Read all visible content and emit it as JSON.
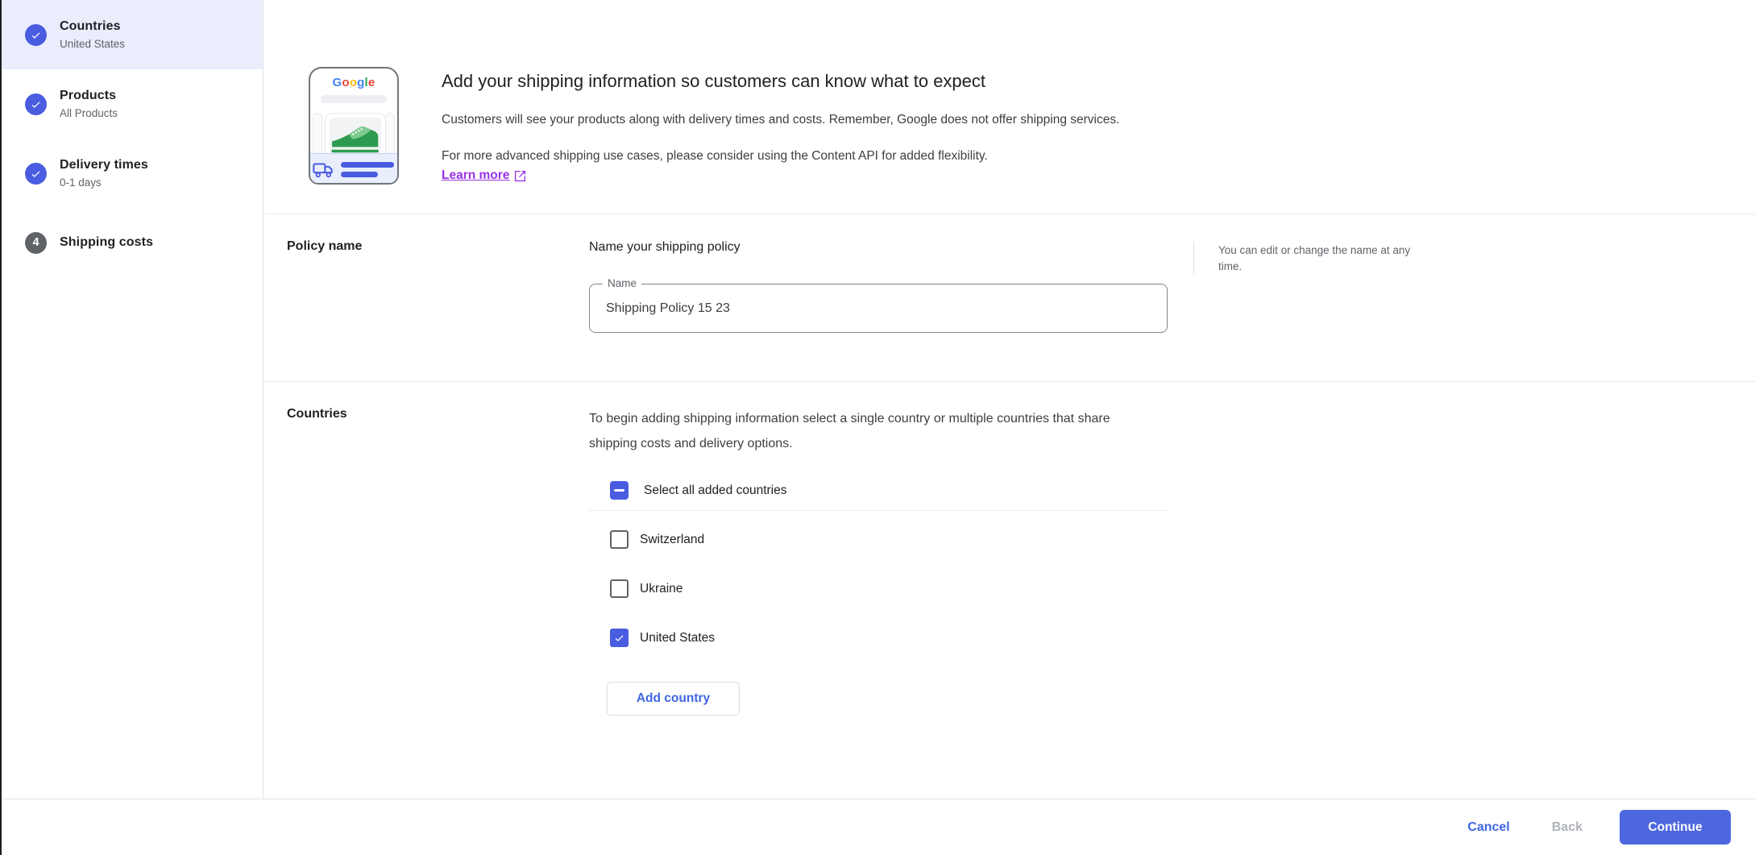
{
  "colors": {
    "control_blue": "#4a5ce0",
    "continue_blue": "#4d68de",
    "action_blue": "#3f66e0",
    "link_purple": "#9933e6",
    "active_step_bg": "#e9edfc",
    "pending_step_gray": "#5f6368",
    "divider": "#e9eaee",
    "google_logo_colors": [
      "#4285F4",
      "#EA4335",
      "#FBBC05",
      "#4285F4",
      "#34A853",
      "#EA4335"
    ],
    "sneaker_green": "#2d9b4f"
  },
  "sidebar": {
    "steps": [
      {
        "title": "Countries",
        "subtitle": "United States",
        "status": "completed",
        "active": true
      },
      {
        "title": "Products",
        "subtitle": "All Products",
        "status": "completed",
        "active": false
      },
      {
        "title": "Delivery times",
        "subtitle": "0-1 days",
        "status": "completed",
        "active": false
      },
      {
        "title": "Shipping costs",
        "subtitle": "",
        "status": "current",
        "number": "4",
        "active": false
      }
    ]
  },
  "header": {
    "title": "Add your shipping information so customers can know what to expect",
    "line1": "Customers will see your products along with delivery times and costs. Remember, Google does not offer shipping services.",
    "line2": "For more advanced shipping use cases, please consider using the Content API for added flexibility.",
    "learn_more_label": "Learn more",
    "logo_letters": [
      {
        "ch": "G"
      },
      {
        "ch": "o"
      },
      {
        "ch": "o"
      },
      {
        "ch": "g"
      },
      {
        "ch": "l"
      },
      {
        "ch": "e"
      }
    ]
  },
  "policy": {
    "label": "Policy name",
    "heading": "Name your shipping policy",
    "field_label": "Name",
    "field_value": "Shipping Policy 15 23",
    "note": "You can edit or change the name at any time."
  },
  "countries": {
    "label": "Countries",
    "intro": "To begin adding shipping information select a single country or multiple countries that share shipping costs and delivery options.",
    "select_all_label": "Select all added countries",
    "select_all_state": "indeterminate",
    "items": [
      {
        "name": "Switzerland",
        "checked": false
      },
      {
        "name": "Ukraine",
        "checked": false
      },
      {
        "name": "United States",
        "checked": true
      }
    ],
    "add_button_label": "Add country"
  },
  "footer": {
    "cancel": "Cancel",
    "back": "Back",
    "continue": "Continue"
  }
}
